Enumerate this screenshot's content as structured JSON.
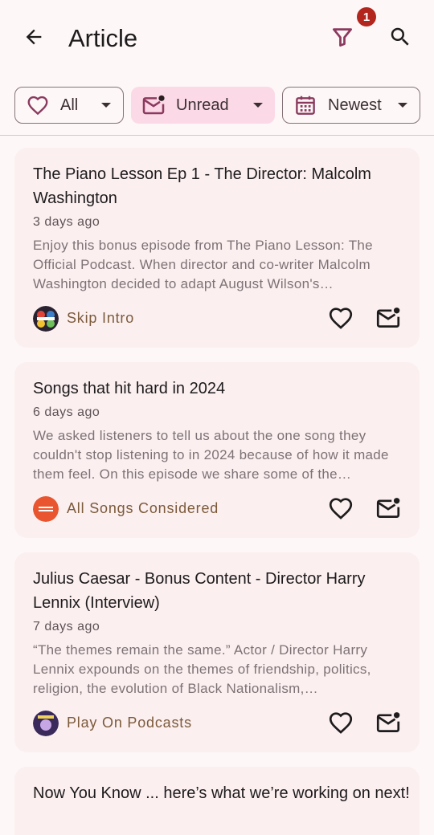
{
  "header": {
    "title": "Article",
    "filter_badge_count": "1"
  },
  "chips": {
    "all_label": "All",
    "unread_label": "Unread",
    "newest_label": "Newest"
  },
  "articles": [
    {
      "title": "The Piano Lesson Ep 1 - The Director: Malcolm Washington",
      "age": "3 days ago",
      "description": "Enjoy this bonus episode from The Piano Lesson: The Official Podcast. When director and co-writer Malcolm Washington decided to adapt August Wilson's…",
      "source": "Skip Intro",
      "avatar_icon": "skip-intro-avatar"
    },
    {
      "title": "Songs that hit hard in 2024",
      "age": "6 days ago",
      "description": "We asked listeners to tell us about the one song they couldn't stop listening to in 2024 because of how it made them feel. On this episode we share some of the…",
      "source": "All Songs Considered",
      "avatar_icon": "all-songs-considered-avatar"
    },
    {
      "title": "Julius Caesar - Bonus Content - Director Harry Lennix (Interview)",
      "age": "7 days ago",
      "description": "“The themes remain the same.” Actor / Director Harry Lennix expounds on the themes of friendship, politics, religion, the evolution of Black Nationalism,…",
      "source": "Play On Podcasts",
      "avatar_icon": "play-on-podcasts-avatar"
    },
    {
      "title": "Now You Know ... here’s what we’re working on next!"
    }
  ],
  "colors": {
    "accent": "#8b3a5e",
    "badge": "#b3261e",
    "source_text": "#7c5a3a",
    "card_bg": "#fbeff0",
    "selected_chip_bg": "#fcd9e6"
  }
}
